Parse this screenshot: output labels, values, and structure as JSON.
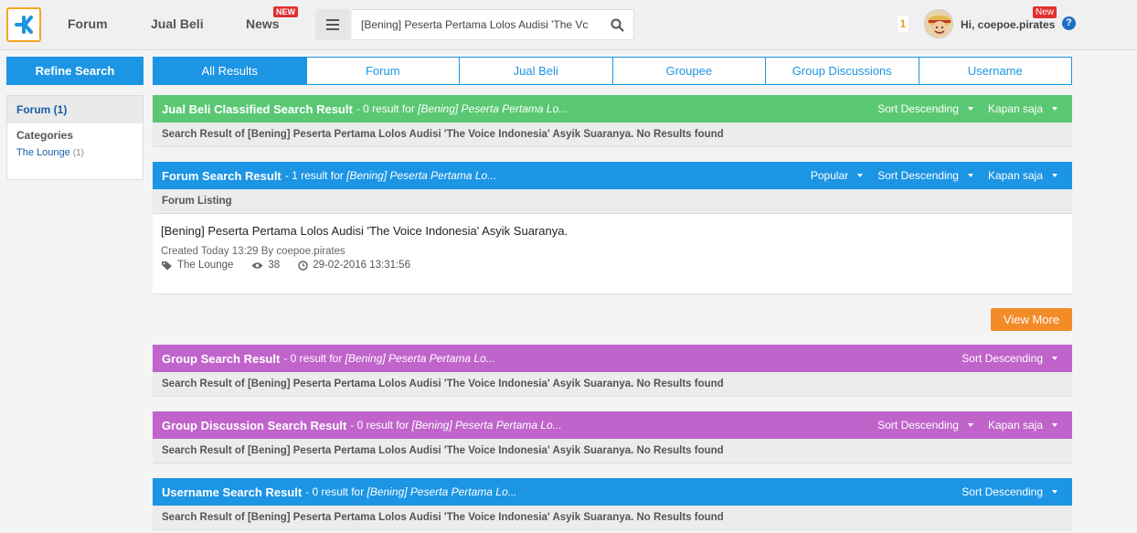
{
  "nav": {
    "forum": "Forum",
    "jual_beli": "Jual Beli",
    "news": "News",
    "news_badge": "NEW",
    "search_value": "[Bening] Peserta Pertama Lolos Audisi 'The Vc",
    "notification_count": "1",
    "greeting": "Hi, coepoe.pirates",
    "user_badge": "New",
    "help": "?"
  },
  "sidebar": {
    "refine_label": "Refine Search",
    "forum_filter": "Forum (1)",
    "categories_title": "Categories",
    "category_item": "The Lounge",
    "category_count": "(1)"
  },
  "tabs": [
    "All Results",
    "Forum",
    "Jual Beli",
    "Groupee",
    "Group Discussions",
    "Username"
  ],
  "sections": {
    "jualbeli": {
      "title": "Jual Beli Classified Search Result",
      "meta": " - 0 result for ",
      "query": "[Bening] Peserta Pertama Lo...",
      "sort": "Sort Descending",
      "time": "Kapan saja",
      "body": "Search Result of [Bening] Peserta Pertama Lolos Audisi 'The Voice Indonesia' Asyik Suaranya. No Results found"
    },
    "forum": {
      "title": "Forum Search Result",
      "meta": " - 1 result for ",
      "query": "[Bening] Peserta Pertama Lo...",
      "popular": "Popular",
      "sort": "Sort Descending",
      "time": "Kapan saja",
      "listing": "Forum Listing",
      "result_title": "[Bening] Peserta Pertama Lolos Audisi 'The Voice Indonesia' Asyik Suaranya.",
      "created": "Created Today 13:29 By coepoe.pirates",
      "category": "The Lounge",
      "views": "38",
      "date": "29-02-2016 13:31:56",
      "view_more": "View More"
    },
    "group": {
      "title": "Group Search Result",
      "meta": " - 0 result for ",
      "query": "[Bening] Peserta Pertama Lo...",
      "sort": "Sort Descending",
      "body": "Search Result of [Bening] Peserta Pertama Lolos Audisi 'The Voice Indonesia' Asyik Suaranya. No Results found"
    },
    "group_discussion": {
      "title": "Group Discussion Search Result",
      "meta": " - 0 result for ",
      "query": "[Bening] Peserta Pertama Lo...",
      "sort": "Sort Descending",
      "time": "Kapan saja",
      "body": "Search Result of [Bening] Peserta Pertama Lolos Audisi 'The Voice Indonesia' Asyik Suaranya. No Results found"
    },
    "username": {
      "title": "Username Search Result",
      "meta": " - 0 result for ",
      "query": "[Bening] Peserta Pertama Lo...",
      "sort": "Sort Descending",
      "body": "Search Result of [Bening] Peserta Pertama Lolos Audisi 'The Voice Indonesia' Asyik Suaranya. No Results found"
    }
  },
  "colors": {
    "brand_blue": "#1c95e4",
    "green": "#5ac873",
    "purple": "#c064cb",
    "orange": "#f28c28",
    "badge_red": "#e03030"
  }
}
